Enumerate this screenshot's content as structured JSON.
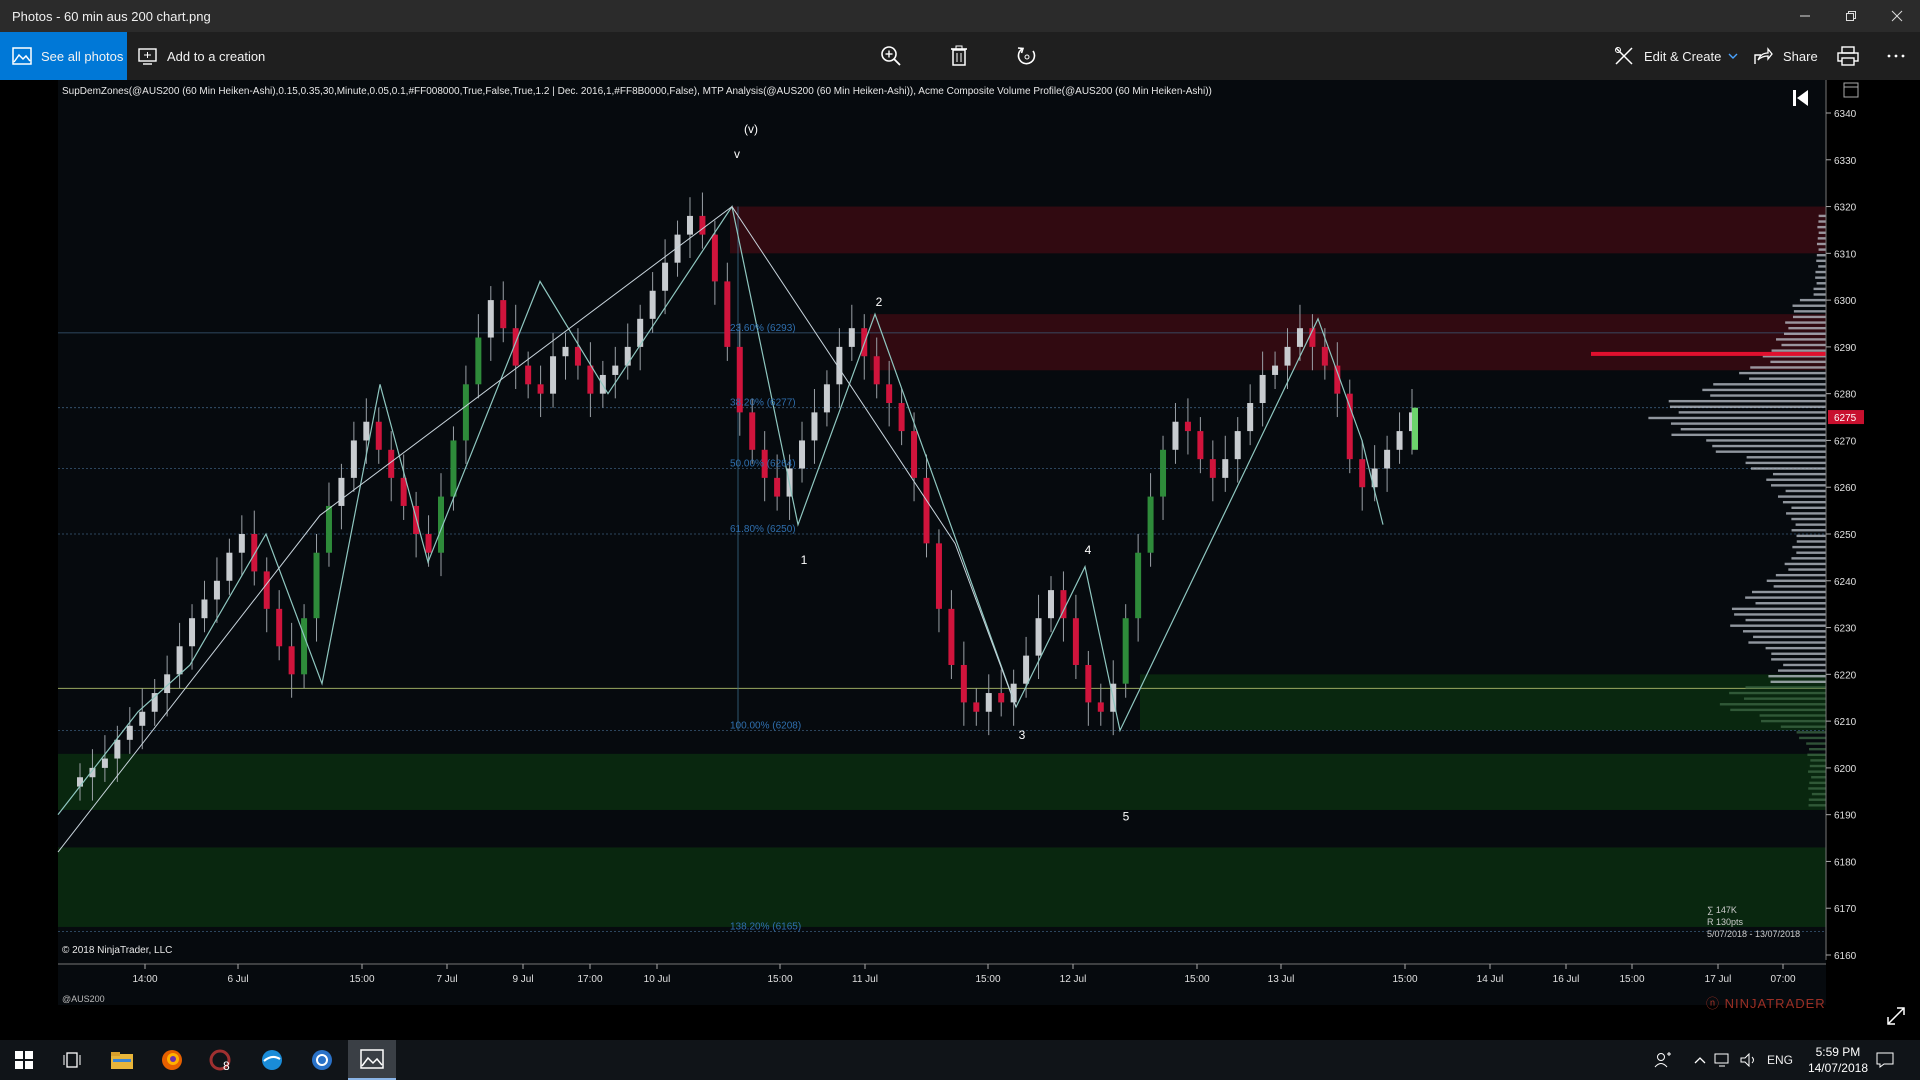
{
  "window": {
    "title": "Photos - 60 min aus 200 chart.png",
    "buttons": [
      "minimize",
      "restore",
      "close"
    ]
  },
  "toolbar": {
    "see_all_label": "See all photos",
    "add_to_creation_label": "Add to a creation",
    "edit_create_label": "Edit & Create",
    "share_label": "Share",
    "icons": [
      "zoom-icon",
      "delete-icon",
      "rotate-icon",
      "print-icon",
      "more-icon"
    ]
  },
  "chart": {
    "indicator_caption": "SupDemZones(@AUS200 (60 Min Heiken-Ashi),0.15,0.35,30,Minute,0.05,0.1,#FF008000,True,False,True,1.2 | Dec. 2016,1,#FF8B0000,False), MTP Analysis(@AUS200 (60 Min Heiken-Ashi)), Acme Composite Volume Profile(@AUS200 (60 Min Heiken-Ashi))",
    "copyright": "© 2018 NinjaTrader, LLC",
    "instrument": "@AUS200",
    "brand": "NINJATRADER",
    "current_price": "6275",
    "stats": {
      "sum": "∑ 147K",
      "range": "R 130pts",
      "dates": "5/07/2018 - 13/07/2018"
    },
    "wave_labels": [
      "(v)",
      "v",
      "2",
      "1",
      "4",
      "3",
      "5"
    ],
    "fib_labels": [
      "23.60% (6293)",
      "38.20% (6277)",
      "50.00% (6264)",
      "61.80% (6250)",
      "100.00% (6208)",
      "138.20% (6165)"
    ],
    "colors": {
      "bull": "#c8ccd0",
      "bear": "#d0143c",
      "green": "#2e8b3a",
      "demand_zone": "#0a2a10",
      "supply_zone": "#3a0a12",
      "fib": "#3a5a78"
    }
  },
  "chart_data": {
    "type": "candlestick",
    "title": "",
    "instrument": "@AUS200",
    "ylim": [
      6160,
      6345
    ],
    "y_ticks": [
      6340,
      6330,
      6320,
      6310,
      6300,
      6290,
      6280,
      6270,
      6260,
      6250,
      6240,
      6230,
      6220,
      6210,
      6200,
      6190,
      6180,
      6170,
      6160
    ],
    "x_tick_labels": [
      "14:00",
      "6 Jul",
      "15:00",
      "7 Jul",
      "9 Jul",
      "17:00",
      "10 Jul",
      "15:00",
      "11 Jul",
      "15:00",
      "12 Jul",
      "15:00",
      "13 Jul",
      "15:00",
      "14 Jul",
      "16 Jul",
      "15:00",
      "17 Jul",
      "07:00"
    ],
    "fib_levels": [
      {
        "label": "23.60% (6293)",
        "value": 6293
      },
      {
        "label": "38.20% (6277)",
        "value": 6277
      },
      {
        "label": "50.00% (6264)",
        "value": 6264
      },
      {
        "label": "61.80% (6250)",
        "value": 6250
      },
      {
        "label": "100.00% (6208)",
        "value": 6208
      },
      {
        "label": "138.20% (6165)",
        "value": 6165
      }
    ],
    "supply_zones": [
      [
        6310,
        6320
      ],
      [
        6285,
        6297
      ]
    ],
    "demand_zones": [
      [
        6208,
        6220
      ],
      [
        6191,
        6203
      ],
      [
        6166,
        6183
      ]
    ],
    "last_price": 6275,
    "wave_points": [
      {
        "label": "(v)",
        "value": 6320
      },
      {
        "label": "1",
        "value": 6252
      },
      {
        "label": "2",
        "value": 6297
      },
      {
        "label": "3",
        "value": 6213
      },
      {
        "label": "4",
        "value": 6243
      },
      {
        "label": "5",
        "value": 6208
      }
    ],
    "close_path": [
      6198,
      6200,
      6202,
      6206,
      6209,
      6212,
      6216,
      6220,
      6226,
      6232,
      6236,
      6240,
      6246,
      6250,
      6242,
      6234,
      6226,
      6220,
      6232,
      6246,
      6256,
      6262,
      6270,
      6274,
      6268,
      6262,
      6256,
      6250,
      6246,
      6258,
      6270,
      6282,
      6292,
      6300,
      6294,
      6286,
      6282,
      6280,
      6288,
      6290,
      6286,
      6280,
      6284,
      6286,
      6290,
      6296,
      6302,
      6308,
      6314,
      6318,
      6314,
      6304,
      6290,
      6276,
      6268,
      6262,
      6258,
      6264,
      6270,
      6276,
      6282,
      6290,
      6294,
      6288,
      6282,
      6278,
      6272,
      6262,
      6248,
      6234,
      6222,
      6214,
      6212,
      6216,
      6214,
      6218,
      6224,
      6232,
      6238,
      6232,
      6222,
      6214,
      6212,
      6218,
      6232,
      6246,
      6258,
      6268,
      6274,
      6272,
      6266,
      6262,
      6266,
      6272,
      6278,
      6284,
      6286,
      6290,
      6294,
      6290,
      6286,
      6280,
      6266,
      6260,
      6264,
      6268,
      6272,
      6276
    ]
  },
  "taskbar": {
    "tray_lang": "ENG",
    "time": "5:59 PM",
    "date": "14/07/2018",
    "apps": [
      "start-icon",
      "task-view-icon",
      "file-explorer-icon",
      "firefox-icon",
      "ninjatrader-icon",
      "app-icon",
      "outlook-icon",
      "photos-icon"
    ]
  }
}
